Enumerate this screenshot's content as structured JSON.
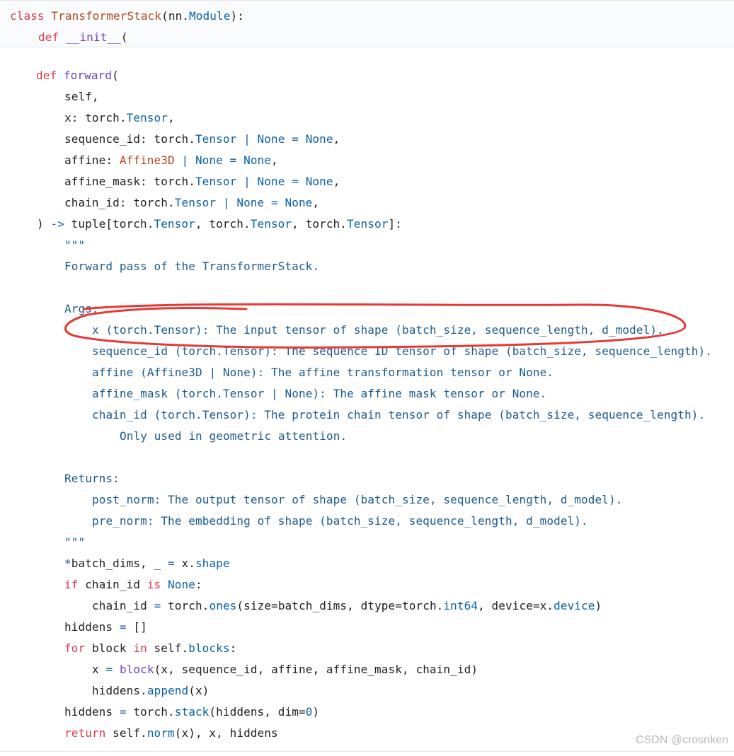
{
  "colors": {
    "keyword": "#d73a49",
    "def": "#a626a4",
    "class_name": "#b4491d",
    "function": "#6f42c1",
    "attribute": "#0b61a4",
    "operator": "#1c5aa6",
    "docstring": "#1e5b8c",
    "annotation_circle": "#e53935"
  },
  "watermark": "CSDN @crosnken",
  "lines": [
    {
      "indent": 0,
      "tokens": [
        [
          "class ",
          "kw"
        ],
        [
          "TransformerStack",
          "cls"
        ],
        [
          "(nn.",
          "plain"
        ],
        [
          "Module",
          "attr"
        ],
        [
          "):",
          "plain"
        ]
      ]
    },
    {
      "indent": 1,
      "tokens": [
        [
          "def ",
          "kw"
        ],
        [
          "__init__",
          "fn"
        ],
        [
          "(",
          "plain"
        ]
      ]
    },
    {
      "indent": 1,
      "tokens": [
        [
          "def ",
          "kw"
        ],
        [
          "forward",
          "fn"
        ],
        [
          "(",
          "plain"
        ]
      ]
    },
    {
      "indent": 2,
      "tokens": [
        [
          "self,",
          "plain"
        ]
      ]
    },
    {
      "indent": 2,
      "tokens": [
        [
          "x: torch.",
          "plain"
        ],
        [
          "Tensor",
          "attr"
        ],
        [
          ",",
          "plain"
        ]
      ]
    },
    {
      "indent": 2,
      "tokens": [
        [
          "sequence_id: torch.",
          "plain"
        ],
        [
          "Tensor",
          "attr"
        ],
        [
          " | ",
          "op"
        ],
        [
          "None",
          "attr"
        ],
        [
          " = ",
          "op"
        ],
        [
          "None",
          "attr"
        ],
        [
          ",",
          "plain"
        ]
      ]
    },
    {
      "indent": 2,
      "tokens": [
        [
          "affine: ",
          "plain"
        ],
        [
          "Affine3D",
          "cls"
        ],
        [
          " | ",
          "op"
        ],
        [
          "None",
          "attr"
        ],
        [
          " = ",
          "op"
        ],
        [
          "None",
          "attr"
        ],
        [
          ",",
          "plain"
        ]
      ]
    },
    {
      "indent": 2,
      "tokens": [
        [
          "affine_mask: torch.",
          "plain"
        ],
        [
          "Tensor",
          "attr"
        ],
        [
          " | ",
          "op"
        ],
        [
          "None",
          "attr"
        ],
        [
          " = ",
          "op"
        ],
        [
          "None",
          "attr"
        ],
        [
          ",",
          "plain"
        ]
      ]
    },
    {
      "indent": 2,
      "tokens": [
        [
          "chain_id: torch.",
          "plain"
        ],
        [
          "Tensor",
          "attr"
        ],
        [
          " | ",
          "op"
        ],
        [
          "None",
          "attr"
        ],
        [
          " = ",
          "op"
        ],
        [
          "None",
          "attr"
        ],
        [
          ",",
          "plain"
        ]
      ]
    },
    {
      "indent": 1,
      "tokens": [
        [
          ") ",
          "plain"
        ],
        [
          "->",
          "op"
        ],
        [
          " tuple[torch.",
          "plain"
        ],
        [
          "Tensor",
          "attr"
        ],
        [
          ", torch.",
          "plain"
        ],
        [
          "Tensor",
          "attr"
        ],
        [
          ", torch.",
          "plain"
        ],
        [
          "Tensor",
          "attr"
        ],
        [
          "]:",
          "plain"
        ]
      ]
    },
    {
      "indent": 2,
      "tokens": [
        [
          "\"\"\"",
          "doc"
        ]
      ]
    },
    {
      "indent": 2,
      "tokens": [
        [
          "Forward pass of the TransformerStack.",
          "doc"
        ]
      ]
    },
    {
      "indent": 2,
      "tokens": [
        [
          "Args:",
          "doc"
        ]
      ]
    },
    {
      "indent": 3,
      "tokens": [
        [
          "x (torch.Tensor): The input tensor of shape (batch_size, sequence_length, d_model).",
          "doc"
        ]
      ]
    },
    {
      "indent": 3,
      "tokens": [
        [
          "sequence_id (torch.Tensor): The sequence ID tensor of shape (batch_size, sequence_length).",
          "doc"
        ]
      ]
    },
    {
      "indent": 3,
      "tokens": [
        [
          "affine (Affine3D | None): The affine transformation tensor or None.",
          "doc"
        ]
      ]
    },
    {
      "indent": 3,
      "tokens": [
        [
          "affine_mask (torch.Tensor | None): The affine mask tensor or None.",
          "doc"
        ]
      ]
    },
    {
      "indent": 3,
      "tokens": [
        [
          "chain_id (torch.Tensor): The protein chain tensor of shape (batch_size, sequence_length).",
          "doc"
        ]
      ]
    },
    {
      "indent": 4,
      "tokens": [
        [
          "Only used in geometric attention.",
          "doc"
        ]
      ]
    },
    {
      "indent": 2,
      "tokens": [
        [
          "Returns:",
          "doc"
        ]
      ]
    },
    {
      "indent": 3,
      "tokens": [
        [
          "post_norm: The output tensor of shape (batch_size, sequence_length, d_model).",
          "doc"
        ]
      ]
    },
    {
      "indent": 3,
      "tokens": [
        [
          "pre_norm: The embedding of shape (batch_size, sequence_length, d_model).",
          "doc"
        ]
      ]
    },
    {
      "indent": 2,
      "tokens": [
        [
          "\"\"\"",
          "doc"
        ]
      ]
    },
    {
      "indent": 2,
      "tokens": [
        [
          "*",
          "op"
        ],
        [
          "batch_dims, _ ",
          "plain"
        ],
        [
          "=",
          "op"
        ],
        [
          " x.",
          "plain"
        ],
        [
          "shape",
          "attr"
        ]
      ]
    },
    {
      "indent": 2,
      "tokens": [
        [
          "if ",
          "kw"
        ],
        [
          "chain_id ",
          "plain"
        ],
        [
          "is ",
          "kw"
        ],
        [
          "None",
          "attr"
        ],
        [
          ":",
          "plain"
        ]
      ]
    },
    {
      "indent": 3,
      "tokens": [
        [
          "chain_id ",
          "plain"
        ],
        [
          "=",
          "op"
        ],
        [
          " torch.",
          "plain"
        ],
        [
          "ones",
          "attr"
        ],
        [
          "(size=batch_dims, dtype=torch.",
          "plain"
        ],
        [
          "int64",
          "attr"
        ],
        [
          ", device=x.",
          "plain"
        ],
        [
          "device",
          "attr"
        ],
        [
          ")",
          "plain"
        ]
      ]
    },
    {
      "indent": 2,
      "tokens": [
        [
          "hiddens ",
          "plain"
        ],
        [
          "=",
          "op"
        ],
        [
          " []",
          "plain"
        ]
      ]
    },
    {
      "indent": 2,
      "tokens": [
        [
          "for ",
          "kw"
        ],
        [
          "block ",
          "plain"
        ],
        [
          "in ",
          "kw"
        ],
        [
          "self.",
          "plain"
        ],
        [
          "blocks",
          "attr"
        ],
        [
          ":",
          "plain"
        ]
      ]
    },
    {
      "indent": 3,
      "tokens": [
        [
          "x ",
          "plain"
        ],
        [
          "=",
          "op"
        ],
        [
          " ",
          "plain"
        ],
        [
          "block",
          "fn"
        ],
        [
          "(x, sequence_id, affine, affine_mask, chain_id)",
          "plain"
        ]
      ]
    },
    {
      "indent": 3,
      "tokens": [
        [
          "hiddens.",
          "plain"
        ],
        [
          "append",
          "attr"
        ],
        [
          "(x)",
          "plain"
        ]
      ]
    },
    {
      "indent": 2,
      "tokens": [
        [
          "hiddens ",
          "plain"
        ],
        [
          "=",
          "op"
        ],
        [
          " torch.",
          "plain"
        ],
        [
          "stack",
          "attr"
        ],
        [
          "(hiddens, dim=",
          "plain"
        ],
        [
          "0",
          "num"
        ],
        [
          ")",
          "plain"
        ]
      ]
    },
    {
      "indent": 2,
      "tokens": [
        [
          "return ",
          "kw"
        ],
        [
          "self.",
          "plain"
        ],
        [
          "norm",
          "attr"
        ],
        [
          "(x), x, hiddens",
          "plain"
        ]
      ]
    }
  ]
}
